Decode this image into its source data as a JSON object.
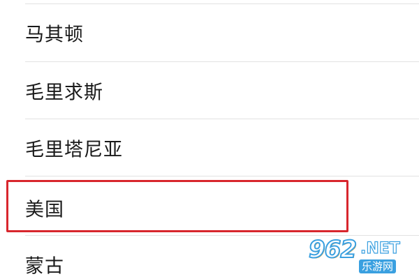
{
  "country_list": {
    "items": [
      {
        "label": "马其顿"
      },
      {
        "label": "毛里求斯"
      },
      {
        "label": "毛里塔尼亚"
      },
      {
        "label": "美国",
        "highlighted": true
      },
      {
        "label": "蒙古"
      }
    ]
  },
  "colors": {
    "highlight_border": "#d8262d",
    "divider": "#e2e2e2",
    "text": "#1a1a1a",
    "watermark_accent": "#3aa0e0"
  },
  "watermark": {
    "logo": "962",
    "net": ".NET",
    "site": "乐游网"
  }
}
